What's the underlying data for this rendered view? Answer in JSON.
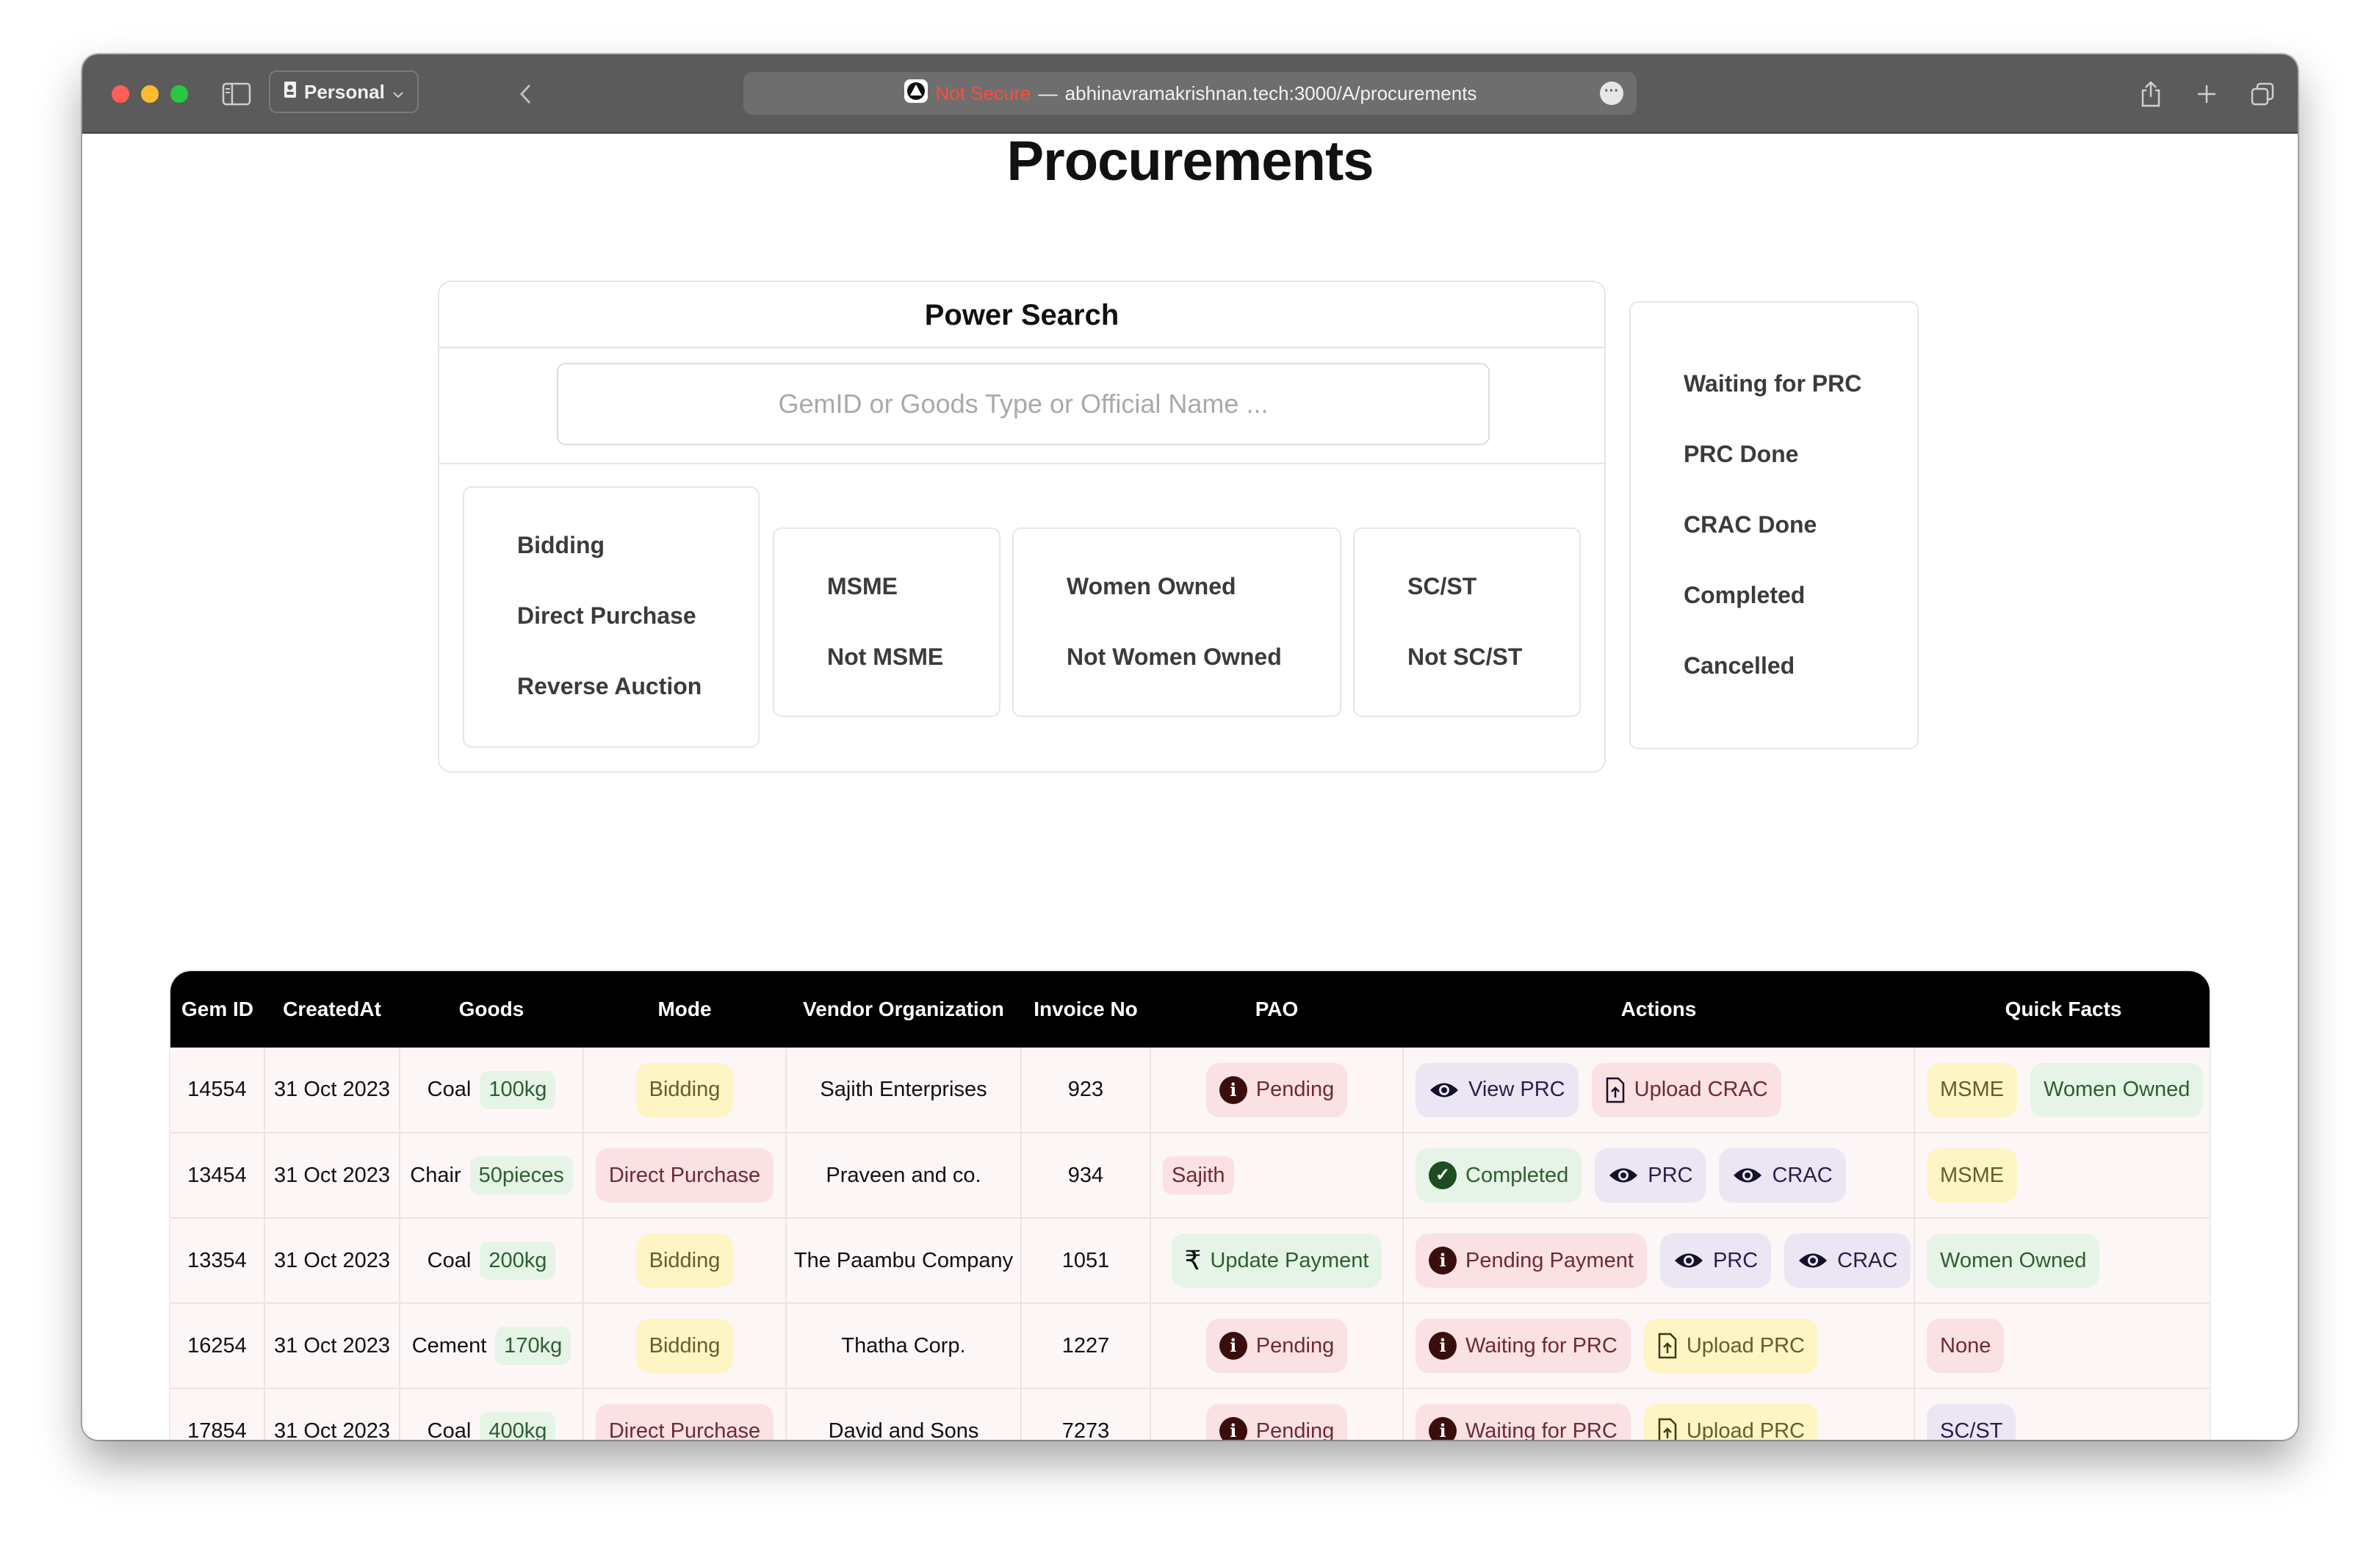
{
  "browser": {
    "profile_label": "Personal",
    "not_secure_label": "Not Secure",
    "url_separator": "—",
    "url": "abhinavramakrishnan.tech:3000/A/procurements"
  },
  "page": {
    "title": "Procurements"
  },
  "power_search": {
    "title": "Power Search",
    "placeholder": "GemID or Goods Type or Official Name ...",
    "mode_filters": [
      "Bidding",
      "Direct Purchase",
      "Reverse Auction"
    ],
    "msme_filters": [
      "MSME",
      "Not MSME"
    ],
    "women_filters": [
      "Women Owned",
      "Not Women Owned"
    ],
    "scst_filters": [
      "SC/ST",
      "Not SC/ST"
    ]
  },
  "status_filters": [
    "Waiting for PRC",
    "PRC Done",
    "CRAC Done",
    "Completed",
    "Cancelled"
  ],
  "table": {
    "headers": [
      "Gem ID",
      "CreatedAt",
      "Goods",
      "Mode",
      "Vendor Organization",
      "Invoice No",
      "PAO",
      "Actions",
      "Quick Facts"
    ],
    "rows": [
      {
        "gem_id": "14554",
        "created_at": "31 Oct 2023",
        "goods": "Coal",
        "qty": "100kg",
        "mode": "Bidding",
        "vendor": "Sajith Enterprises",
        "invoice": "923",
        "pao": "Pending",
        "actions": [
          "View PRC",
          "Upload CRAC"
        ],
        "facts": [
          "MSME",
          "Women Owned"
        ]
      },
      {
        "gem_id": "13454",
        "created_at": "31 Oct 2023",
        "goods": "Chair",
        "qty": "50pieces",
        "mode": "Direct Purchase",
        "vendor": "Praveen and co.",
        "invoice": "934",
        "pao": "Sajith",
        "actions": [
          "Completed",
          "PRC",
          "CRAC"
        ],
        "facts": [
          "MSME"
        ]
      },
      {
        "gem_id": "13354",
        "created_at": "31 Oct 2023",
        "goods": "Coal",
        "qty": "200kg",
        "mode": "Bidding",
        "vendor": "The Paambu Company",
        "invoice": "1051",
        "pao": "Update Payment",
        "actions": [
          "Pending Payment",
          "PRC",
          "CRAC"
        ],
        "facts": [
          "Women Owned"
        ]
      },
      {
        "gem_id": "16254",
        "created_at": "31 Oct 2023",
        "goods": "Cement",
        "qty": "170kg",
        "mode": "Bidding",
        "vendor": "Thatha Corp.",
        "invoice": "1227",
        "pao": "Pending",
        "actions": [
          "Waiting for PRC",
          "Upload PRC"
        ],
        "facts": [
          "None"
        ]
      },
      {
        "gem_id": "17854",
        "created_at": "31 Oct 2023",
        "goods": "Coal",
        "qty": "400kg",
        "mode": "Direct Purchase",
        "vendor": "David and Sons",
        "invoice": "7273",
        "pao": "Pending",
        "actions": [
          "Waiting for PRC",
          "Upload PRC"
        ],
        "facts": [
          "SC/ST"
        ]
      }
    ]
  }
}
